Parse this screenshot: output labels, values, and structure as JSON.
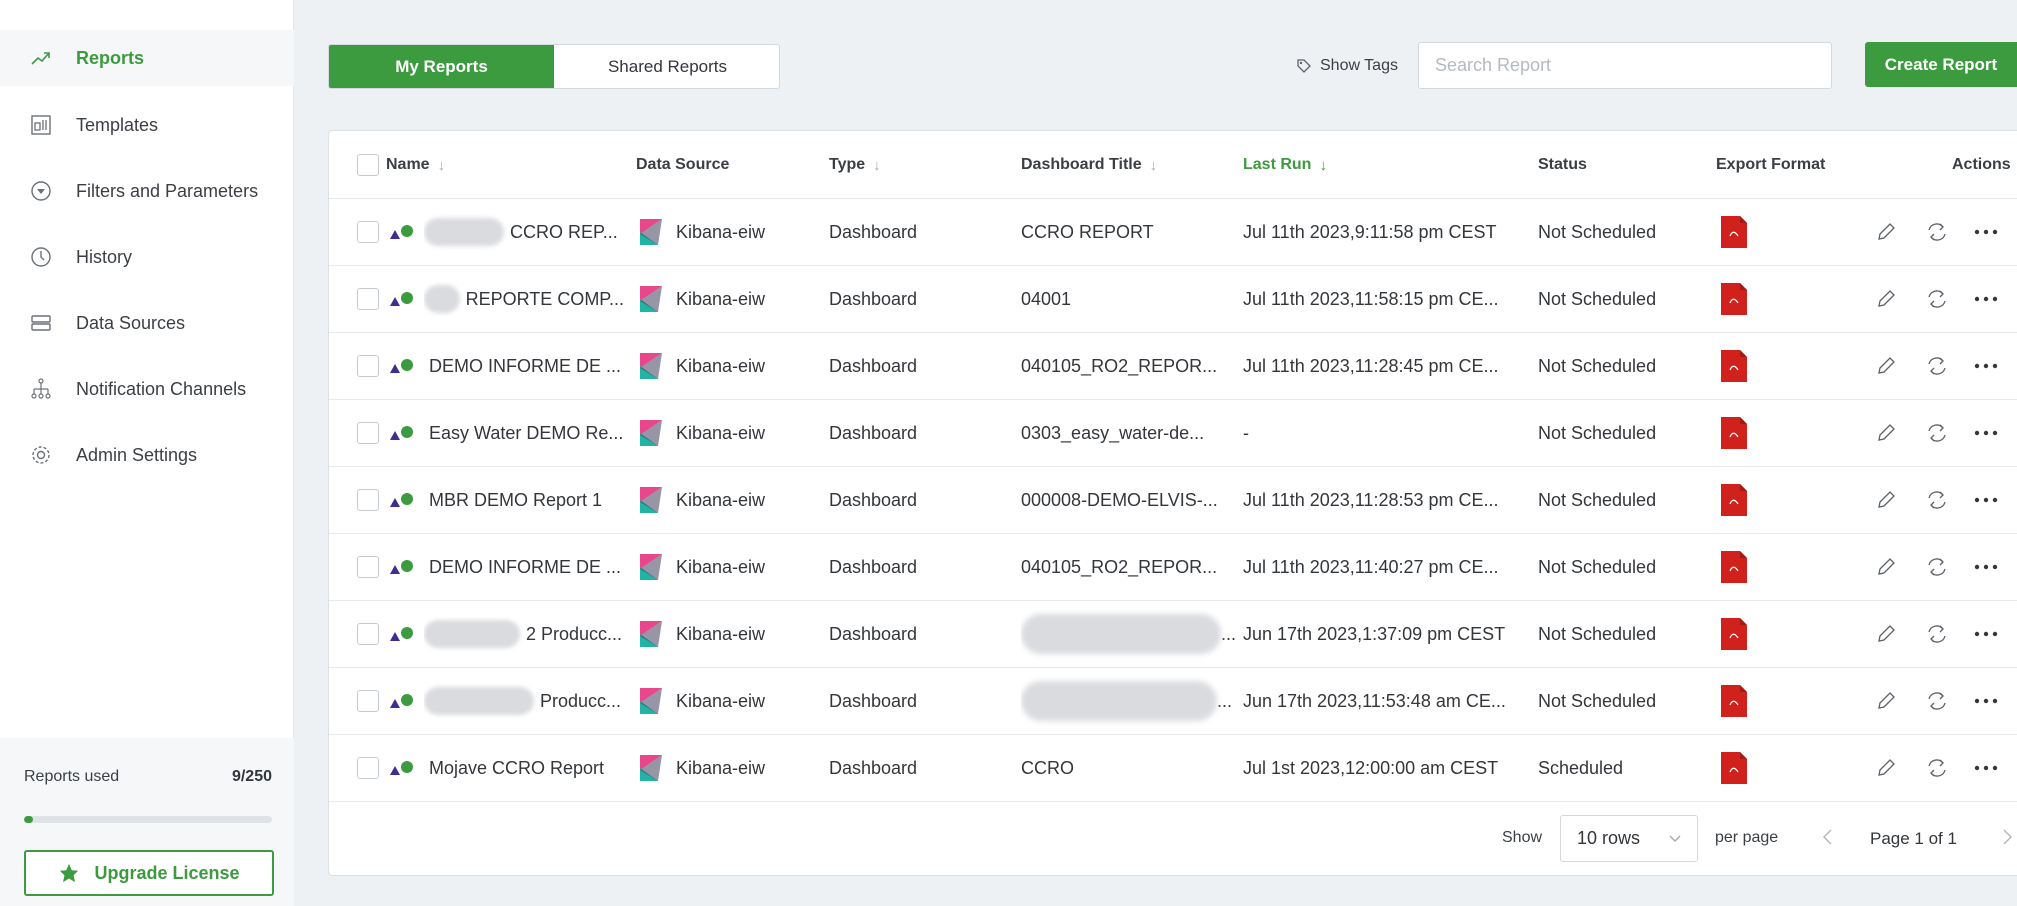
{
  "sidebar": {
    "items": [
      {
        "label": "Reports",
        "icon": "trending-up-icon",
        "active": true
      },
      {
        "label": "Templates",
        "icon": "template-icon",
        "active": false
      },
      {
        "label": "Filters and Parameters",
        "icon": "filter-icon",
        "active": false
      },
      {
        "label": "History",
        "icon": "clock-icon",
        "active": false
      },
      {
        "label": "Data Sources",
        "icon": "database-icon",
        "active": false
      },
      {
        "label": "Notification Channels",
        "icon": "hierarchy-icon",
        "active": false
      },
      {
        "label": "Admin Settings",
        "icon": "gear-icon",
        "active": false
      }
    ],
    "usage": {
      "label": "Reports used",
      "count": "9/250",
      "fraction": 0.036
    },
    "upgrade_label": "Upgrade License"
  },
  "toolbar": {
    "tab_my": "My Reports",
    "tab_shared": "Shared Reports",
    "show_tags": "Show Tags",
    "search_placeholder": "Search Report",
    "create_label": "Create Report"
  },
  "table": {
    "columns": {
      "name": "Name",
      "source": "Data Source",
      "type": "Type",
      "dashboard": "Dashboard Title",
      "lastrun": "Last Run",
      "status": "Status",
      "export": "Export Format",
      "actions": "Actions"
    },
    "rows": [
      {
        "name": "CCRO REP...",
        "source": "Kibana-eiw",
        "type": "Dashboard",
        "dashboard": "CCRO REPORT",
        "lastrun": "Jul 11th 2023,9:11:58 pm CEST",
        "status": "Not Scheduled"
      },
      {
        "name": "REPORTE COMP...",
        "source": "Kibana-eiw",
        "type": "Dashboard",
        "dashboard": "04001",
        "lastrun": "Jul 11th 2023,11:58:15 pm CE...",
        "status": "Not Scheduled"
      },
      {
        "name": "DEMO INFORME DE ...",
        "source": "Kibana-eiw",
        "type": "Dashboard",
        "dashboard": "040105_RO2_REPOR...",
        "lastrun": "Jul 11th 2023,11:28:45 pm CE...",
        "status": "Not Scheduled"
      },
      {
        "name": "Easy Water DEMO Re...",
        "source": "Kibana-eiw",
        "type": "Dashboard",
        "dashboard": "0303_easy_water-de...",
        "lastrun": "-",
        "status": "Not Scheduled"
      },
      {
        "name": "MBR DEMO Report 1",
        "source": "Kibana-eiw",
        "type": "Dashboard",
        "dashboard": "000008-DEMO-ELVIS-...",
        "lastrun": "Jul 11th 2023,11:28:53 pm CE...",
        "status": "Not Scheduled"
      },
      {
        "name": "DEMO INFORME DE ...",
        "source": "Kibana-eiw",
        "type": "Dashboard",
        "dashboard": "040105_RO2_REPOR...",
        "lastrun": "Jul 11th 2023,11:40:27 pm CE...",
        "status": "Not Scheduled"
      },
      {
        "name": "2 Producc...",
        "source": "Kibana-eiw",
        "type": "Dashboard",
        "dashboard": "...",
        "lastrun": "Jun 17th 2023,1:37:09 pm CEST",
        "status": "Not Scheduled"
      },
      {
        "name": "Producc...",
        "source": "Kibana-eiw",
        "type": "Dashboard",
        "dashboard": "...",
        "lastrun": "Jun 17th 2023,11:53:48 am CE...",
        "status": "Not Scheduled"
      },
      {
        "name": "Mojave CCRO Report",
        "source": "Kibana-eiw",
        "type": "Dashboard",
        "dashboard": "CCRO",
        "lastrun": "Jul 1st 2023,12:00:00 am CEST",
        "status": "Scheduled"
      }
    ]
  },
  "footer": {
    "show_label": "Show",
    "rows_value": "10 rows",
    "per_page_label": "per page",
    "page_label": "Page 1 of 1"
  },
  "colors": {
    "accent": "#3d9b3f",
    "pdf_red": "#d0211c",
    "kibana_pink": "#e8488b",
    "kibana_teal": "#21b3a4"
  }
}
